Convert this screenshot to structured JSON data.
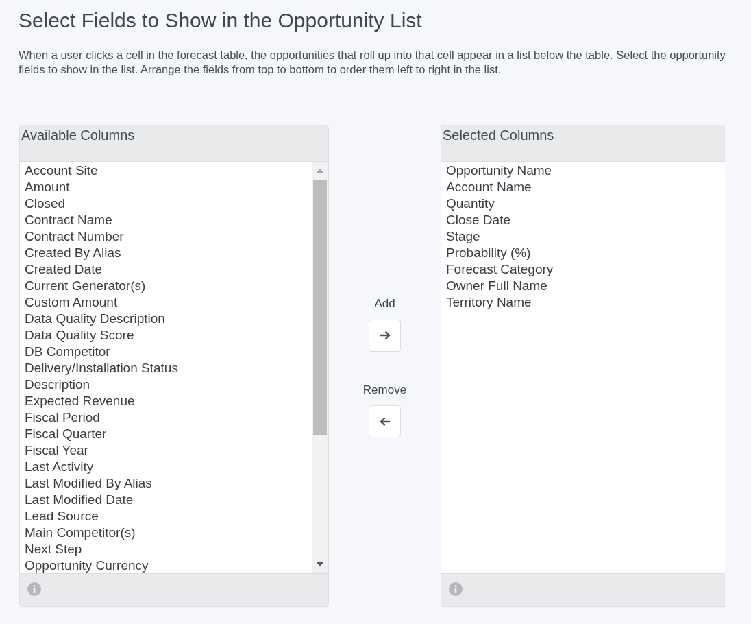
{
  "title": "Select Fields to Show in the Opportunity List",
  "description": "When a user clicks a cell in the forecast table, the opportunities that roll up into that cell appear in a list below the table. Select the opportunity fields to show in the list. Arrange the fields from top to bottom to order them left to right in the list.",
  "available_columns": {
    "heading": "Available Columns",
    "items": [
      "Account Site",
      "Amount",
      "Closed",
      "Contract Name",
      "Contract Number",
      "Created By Alias",
      "Created Date",
      "Current Generator(s)",
      "Custom Amount",
      "Data Quality Description",
      "Data Quality Score",
      "DB Competitor",
      "Delivery/Installation Status",
      "Description",
      "Expected Revenue",
      "Fiscal Period",
      "Fiscal Quarter",
      "Fiscal Year",
      "Last Activity",
      "Last Modified By Alias",
      "Last Modified Date",
      "Lead Source",
      "Main Competitor(s)",
      "Next Step",
      "Opportunity Currency"
    ]
  },
  "actions": {
    "add_label": "Add",
    "remove_label": "Remove"
  },
  "selected_columns": {
    "heading": "Selected Columns",
    "items": [
      "Opportunity Name",
      "Account Name",
      "Quantity",
      "Close Date",
      "Stage",
      "Probability (%)",
      "Forecast Category",
      "Owner Full Name",
      "Territory Name"
    ]
  }
}
